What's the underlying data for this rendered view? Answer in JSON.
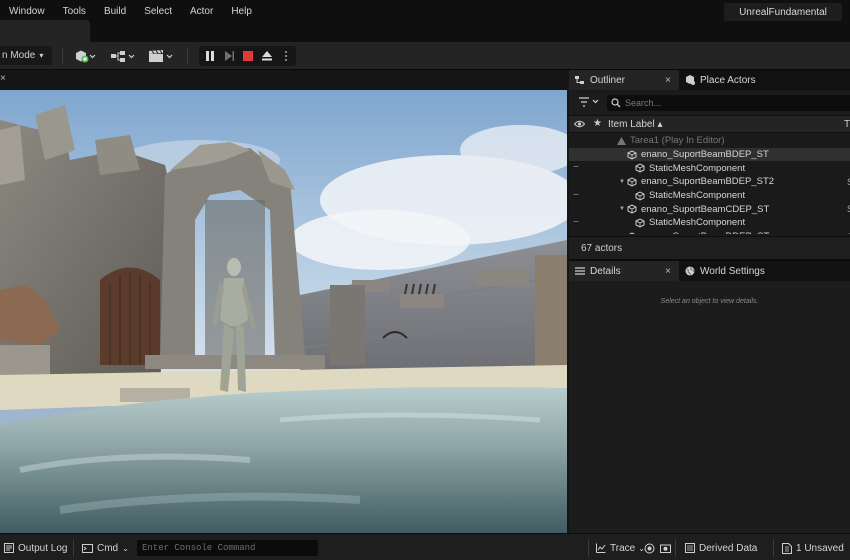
{
  "menu": [
    "Window",
    "Tools",
    "Build",
    "Select",
    "Actor",
    "Help"
  ],
  "project_name": "UnrealFundamental",
  "toolbar": {
    "mode_label": "n Mode",
    "chevron": "⌄"
  },
  "viewport": {
    "close_glyph": "×"
  },
  "outliner": {
    "tab_label": "Outliner",
    "tab_close": "×",
    "place_actors_label": "Place Actors",
    "search_placeholder": "Search...",
    "col_star": "★",
    "col_label": "Item Label ▴",
    "col_type": "T",
    "rows": [
      {
        "label": "Tarea1 (Play In Editor)",
        "indent": 48,
        "kind": "world",
        "dim": true,
        "vis": "",
        "arrow": "",
        "trail": ""
      },
      {
        "label": "enano_SuportBeamBDEP_ST",
        "indent": 58,
        "kind": "cube",
        "dim": false,
        "vis": "",
        "arrow": "",
        "selected": true,
        "trail": ""
      },
      {
        "label": "StaticMeshComponent",
        "indent": 66,
        "kind": "cube",
        "dim": false,
        "vis": "⌣",
        "arrow": "",
        "trail": "("
      },
      {
        "label": "enano_SuportBeamBDEP_ST2",
        "indent": 50,
        "kind": "cube",
        "dim": false,
        "vis": "",
        "arrow": "▼",
        "trail": "S"
      },
      {
        "label": "StaticMeshComponent",
        "indent": 66,
        "kind": "cube",
        "dim": false,
        "vis": "⌣",
        "arrow": "",
        "trail": "("
      },
      {
        "label": "enano_SuportBeamCDEP_ST",
        "indent": 50,
        "kind": "cube",
        "dim": false,
        "vis": "",
        "arrow": "▼",
        "trail": "S"
      },
      {
        "label": "StaticMeshComponent",
        "indent": 66,
        "kind": "cube",
        "dim": false,
        "vis": "⌣",
        "arrow": "",
        "trail": "("
      },
      {
        "label": "enano_SuportBeamDDEP_ST",
        "indent": 50,
        "kind": "cube",
        "dim": false,
        "vis": "",
        "arrow": "▼",
        "trail": "S"
      }
    ],
    "actor_count": "67 actors"
  },
  "details": {
    "tab_label": "Details",
    "tab_close": "×",
    "world_settings_label": "World Settings",
    "empty_text": "Select an object to view details."
  },
  "statusbar": {
    "output_log": "Output Log",
    "cmd": "Cmd",
    "cmd_chevron": "⌄",
    "console_placeholder": "Enter Console Command",
    "trace": "Trace",
    "trace_chevron": "⌄",
    "derived_data": "Derived Data",
    "unsaved": "1 Unsaved"
  },
  "colors": {
    "accent_record": "#e03a3a",
    "play_disabled": "#6f6f6f",
    "add_green": "#4fbf5a"
  }
}
